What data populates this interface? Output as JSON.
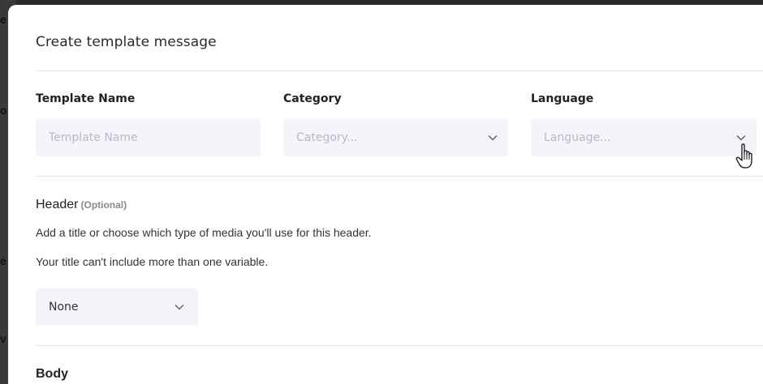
{
  "background": {
    "fragments": [
      "e",
      "o",
      "e",
      "v"
    ]
  },
  "modal": {
    "title": "Create template message"
  },
  "fields": {
    "template_name": {
      "label": "Template Name",
      "placeholder": "Template Name",
      "value": ""
    },
    "category": {
      "label": "Category",
      "placeholder": "Category..."
    },
    "language": {
      "label": "Language",
      "placeholder": "Language..."
    }
  },
  "header_section": {
    "title": "Header",
    "optional": "(Optional)",
    "description": "Add a title or choose which type of media you'll use for this header.",
    "note": "Your title can't include more than one variable.",
    "select_value": "None"
  },
  "body_section": {
    "title": "Body"
  },
  "colors": {
    "input_bg": "#f4f4fb",
    "placeholder": "#b8b8c6",
    "divider": "#e4e4e8"
  },
  "icons": {
    "dropdown": "chevron-down-icon",
    "cursor": "hand-pointer-icon"
  }
}
